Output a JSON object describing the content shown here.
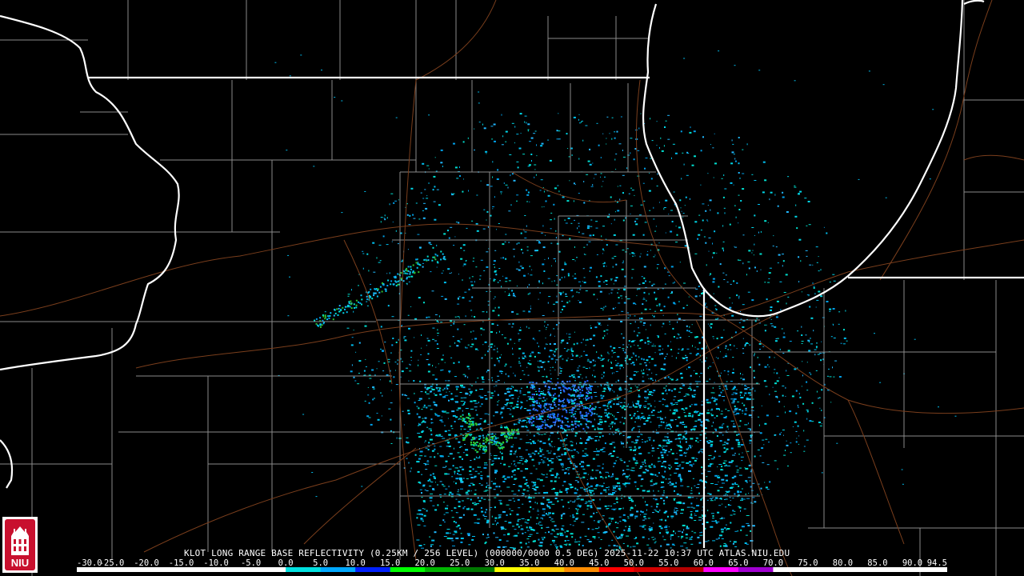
{
  "product_title": "KLOT LONG RANGE BASE REFLECTIVITY (0.25KM / 256 LEVEL) (000000/0000 0.5 DEG) 2025-11-22 10:37 UTC  ATLAS.NIU.EDU",
  "scale": {
    "labels": [
      "-30.0",
      "-25.0",
      "-20.0",
      "-15.0",
      "-10.0",
      "-5.0",
      "0.0",
      "5.0",
      "10.0",
      "15.0",
      "20.0",
      "25.0",
      "30.0",
      "35.0",
      "40.0",
      "45.0",
      "50.0",
      "55.0",
      "60.0",
      "65.0",
      "70.0",
      "75.0",
      "80.0",
      "85.0",
      "90.0",
      "94.5"
    ],
    "colors": [
      "#ffffff",
      "#ffffff",
      "#ffffff",
      "#ffffff",
      "#ffffff",
      "#ffffff",
      "#00e0e0",
      "#00a8ff",
      "#0020ff",
      "#00ff00",
      "#00b400",
      "#007800",
      "#ffff00",
      "#ffc800",
      "#ff8c00",
      "#ff0000",
      "#d20000",
      "#b40000",
      "#ff00ff",
      "#a000d0",
      "#ffffff",
      "#ffffff",
      "#ffffff",
      "#ffffff",
      "#ffffff"
    ]
  },
  "logo": {
    "text": "NIU",
    "color": "#c8102e"
  },
  "colors": {
    "background": "#000000",
    "state_border": "#ffffff",
    "county_border": "#909090",
    "road": "#8b4513"
  }
}
